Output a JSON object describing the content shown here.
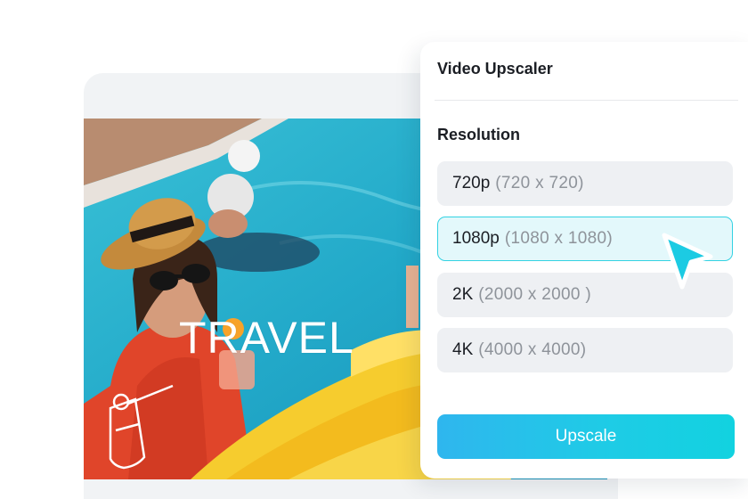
{
  "photo": {
    "overlay_text": "TRAVEL"
  },
  "panel": {
    "title": "Video Upscaler",
    "section_label": "Resolution",
    "options": [
      {
        "name": "720p",
        "dims": "(720 x 720)",
        "selected": false
      },
      {
        "name": "1080p",
        "dims": "(1080 x 1080)",
        "selected": true
      },
      {
        "name": "2K",
        "dims": "(2000 x 2000 )",
        "selected": false
      },
      {
        "name": "4K",
        "dims": "(4000 x 4000)",
        "selected": false
      }
    ],
    "upscale_label": "Upscale"
  },
  "colors": {
    "accent": "#1fcbe6",
    "selected_bg": "#e3f8fb",
    "option_bg": "#eef0f3",
    "cursor": "#1ccbe3"
  },
  "icons": {
    "cursor": "mouse-pointer-icon",
    "drink": "drink-glass-icon"
  }
}
